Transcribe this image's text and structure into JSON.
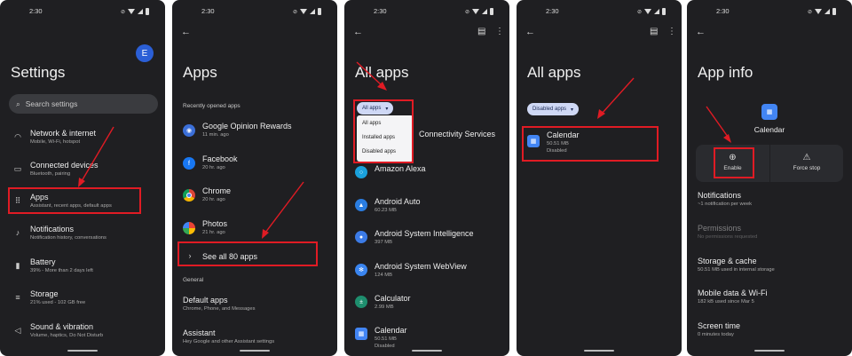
{
  "status_time": "2:30",
  "screen1": {
    "avatar": "E",
    "title": "Settings",
    "search_placeholder": "Search settings",
    "items": [
      {
        "icon": "wifi-icon",
        "title": "Network & internet",
        "subtitle": "Mobile, Wi-Fi, hotspot"
      },
      {
        "icon": "devices-icon",
        "title": "Connected devices",
        "subtitle": "Bluetooth, pairing"
      },
      {
        "icon": "apps-grid-icon",
        "title": "Apps",
        "subtitle": "Assistant, recent apps, default apps"
      },
      {
        "icon": "bell-icon",
        "title": "Notifications",
        "subtitle": "Notification history, conversations"
      },
      {
        "icon": "battery-icon",
        "title": "Battery",
        "subtitle": "39% - More than 2 days left"
      },
      {
        "icon": "storage-icon",
        "title": "Storage",
        "subtitle": "21% used - 102 GB free"
      },
      {
        "icon": "speaker-icon",
        "title": "Sound & vibration",
        "subtitle": "Volume, haptics, Do Not Disturb"
      }
    ]
  },
  "screen2": {
    "title": "Apps",
    "recent_label": "Recently opened apps",
    "recent": [
      {
        "name": "Google Opinion Rewards",
        "time": "11 min. ago",
        "color": "#3b6fd8"
      },
      {
        "name": "Facebook",
        "time": "20 hr. ago",
        "color": "#1877f2"
      },
      {
        "name": "Chrome",
        "time": "20 hr. ago",
        "color": "#db4437"
      },
      {
        "name": "Photos",
        "time": "21 hr. ago",
        "color": "#f4b400"
      }
    ],
    "see_all": "See all 80 apps",
    "general_label": "General",
    "general": [
      {
        "title": "Default apps",
        "subtitle": "Chrome, Phone, and Messages"
      },
      {
        "title": "Assistant",
        "subtitle": "Hey Google and other Assistant settings"
      }
    ]
  },
  "screen3": {
    "title": "All apps",
    "filter_selected": "All apps",
    "filter_options": [
      "All apps",
      "Installed apps",
      "Disabled apps"
    ],
    "partial_item": "Connectivity Services",
    "apps": [
      {
        "name": "Amazon Alexa",
        "size": "",
        "color": "#1aa1dc"
      },
      {
        "name": "Android Auto",
        "size": "60.23 MB",
        "color": "#2a7de1"
      },
      {
        "name": "Android System Intelligence",
        "size": "397 MB",
        "color": "#3c7be6"
      },
      {
        "name": "Android System WebView",
        "size": "124 MB",
        "color": "#3a85f0"
      },
      {
        "name": "Calculator",
        "size": "2.99 MB",
        "color": "#1e8e6e"
      },
      {
        "name": "Calendar",
        "size": "50.51 MB",
        "status": "Disabled",
        "color": "#4285f4"
      }
    ]
  },
  "screen4": {
    "title": "All apps",
    "filter_selected": "Disabled apps",
    "app": {
      "name": "Calendar",
      "size": "50.51 MB",
      "status": "Disabled"
    }
  },
  "screen5": {
    "title": "App info",
    "app_name": "Calendar",
    "enable_label": "Enable",
    "force_stop_label": "Force stop",
    "items": [
      {
        "title": "Notifications",
        "subtitle": "~1 notification per week",
        "dim": false
      },
      {
        "title": "Permissions",
        "subtitle": "No permissions requested",
        "dim": true
      },
      {
        "title": "Storage & cache",
        "subtitle": "50.51 MB used in internal storage",
        "dim": false
      },
      {
        "title": "Mobile data & Wi-Fi",
        "subtitle": "182 kB used since Mar 5",
        "dim": false
      },
      {
        "title": "Screen time",
        "subtitle": "0 minutes today",
        "dim": false
      }
    ]
  },
  "colors": {
    "highlight": "#e01b24",
    "screen_bg": "#1f1f22"
  }
}
